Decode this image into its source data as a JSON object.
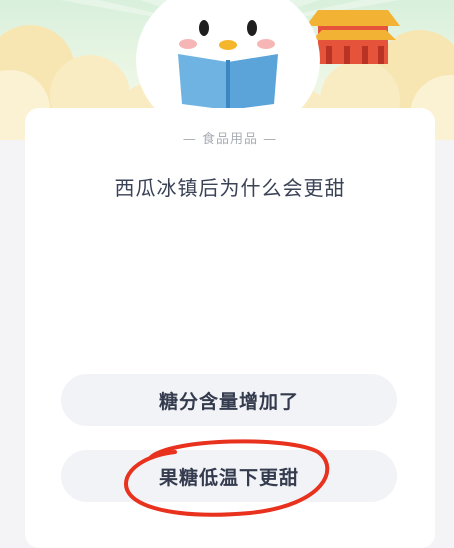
{
  "header": {
    "illustration": "penguin-mascot-reading-book"
  },
  "quiz": {
    "category": "— 食品用品 —",
    "question": "西瓜冰镇后为什么会更甜",
    "options": [
      {
        "label": "糖分含量增加了"
      },
      {
        "label": "果糖低温下更甜",
        "annotated": true
      }
    ]
  },
  "colors": {
    "annotation": "#e8321e",
    "card": "#ffffff",
    "option_bg": "#f2f3f6",
    "question_text": "#3a4256"
  }
}
